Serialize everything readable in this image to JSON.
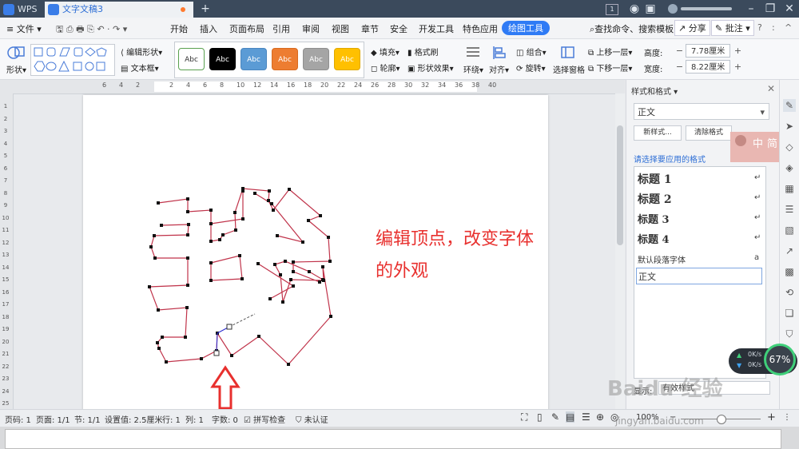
{
  "titlebar": {
    "app_tab": "WPS",
    "doc_tab": "文字文稿3",
    "new_tab": "+",
    "page_badge": "1"
  },
  "menubar": {
    "file": "文件",
    "items": [
      "开始",
      "插入",
      "页面布局",
      "引用",
      "审阅",
      "视图",
      "章节",
      "安全",
      "开发工具",
      "特色应用"
    ],
    "active": "绘图工具",
    "search": "查找命令、搜索模板",
    "share": "分享",
    "comment": "批注"
  },
  "ribbon": {
    "shape": "形状",
    "edit_shape": "编辑形状",
    "text_box": "文本框",
    "swatches": [
      {
        "label": "Abc",
        "bg": "#ffffff",
        "fg": "#333333",
        "border": "#59a14f"
      },
      {
        "label": "Abc",
        "bg": "#000000",
        "fg": "#ffffff",
        "border": "#000000"
      },
      {
        "label": "Abc",
        "bg": "#5b9bd5",
        "fg": "#ffffff",
        "border": "#4a86c0"
      },
      {
        "label": "Abc",
        "bg": "#ed7d31",
        "fg": "#ffffff",
        "border": "#d86b20"
      },
      {
        "label": "Abc",
        "bg": "#a5a5a5",
        "fg": "#ffffff",
        "border": "#8f8f8f"
      },
      {
        "label": "Abc",
        "bg": "#ffc000",
        "fg": "#ffffff",
        "border": "#e0a800"
      }
    ],
    "fill": "填充",
    "format_painter": "格式刷",
    "outline": "轮廓",
    "shape_effect": "形状效果",
    "wrap": "环绕",
    "align": "对齐",
    "group": "组合",
    "rotate": "旋转",
    "select_pane": "选择窗格",
    "bring_forward": "上移一层",
    "send_backward": "下移一层",
    "height_label": "高度:",
    "height_value": "7.78厘米",
    "width_label": "宽度:",
    "width_value": "8.22厘米"
  },
  "ruler": {
    "labels": [
      "6",
      "4",
      "2",
      "",
      "2",
      "4",
      "6",
      "8",
      "10",
      "12",
      "14",
      "16",
      "18",
      "20",
      "22",
      "24",
      "26",
      "28",
      "30",
      "32",
      "34",
      "36",
      "38",
      "40"
    ],
    "vlabels": [
      "1",
      "2",
      "3",
      "4",
      "5",
      "6",
      "7",
      "8",
      "9",
      "10",
      "11",
      "12",
      "13",
      "14",
      "15",
      "16",
      "17",
      "18",
      "19",
      "20",
      "21",
      "22",
      "23",
      "24",
      "25"
    ]
  },
  "document": {
    "annotation_line1": "编辑顶点，改变字体",
    "annotation_line2": "的外观",
    "annotation_color": "#e8302e",
    "shape_outline_color": "#c0334a"
  },
  "panel": {
    "title": "样式和格式",
    "current_style": "正文",
    "new_style": "新样式...",
    "clear_format": "清除格式",
    "apply_label": "请选择要应用的格式",
    "styles": [
      "标题 1",
      "标题 2",
      "标题 3",
      "标题 4",
      "默认段落字体",
      "正文"
    ],
    "show_label": "显示:",
    "show_value": "有效样式",
    "ime_zh": "中",
    "ime_simp": "简"
  },
  "net_widget": {
    "up": "0K/s",
    "down": "0K/s",
    "percent": "67%"
  },
  "status": {
    "page": "页码: 1",
    "pages": "页面: 1/1",
    "section": "节: 1/1",
    "setting": "设置值: 2.5厘米",
    "row": "行: 1",
    "col": "列: 1",
    "words": "字数: 0",
    "spell": "拼写检查",
    "cert": "未认证",
    "zoom": "100%"
  },
  "watermark": {
    "line1": "Baidu 经验",
    "line2": "jingyan.baidu.com"
  }
}
